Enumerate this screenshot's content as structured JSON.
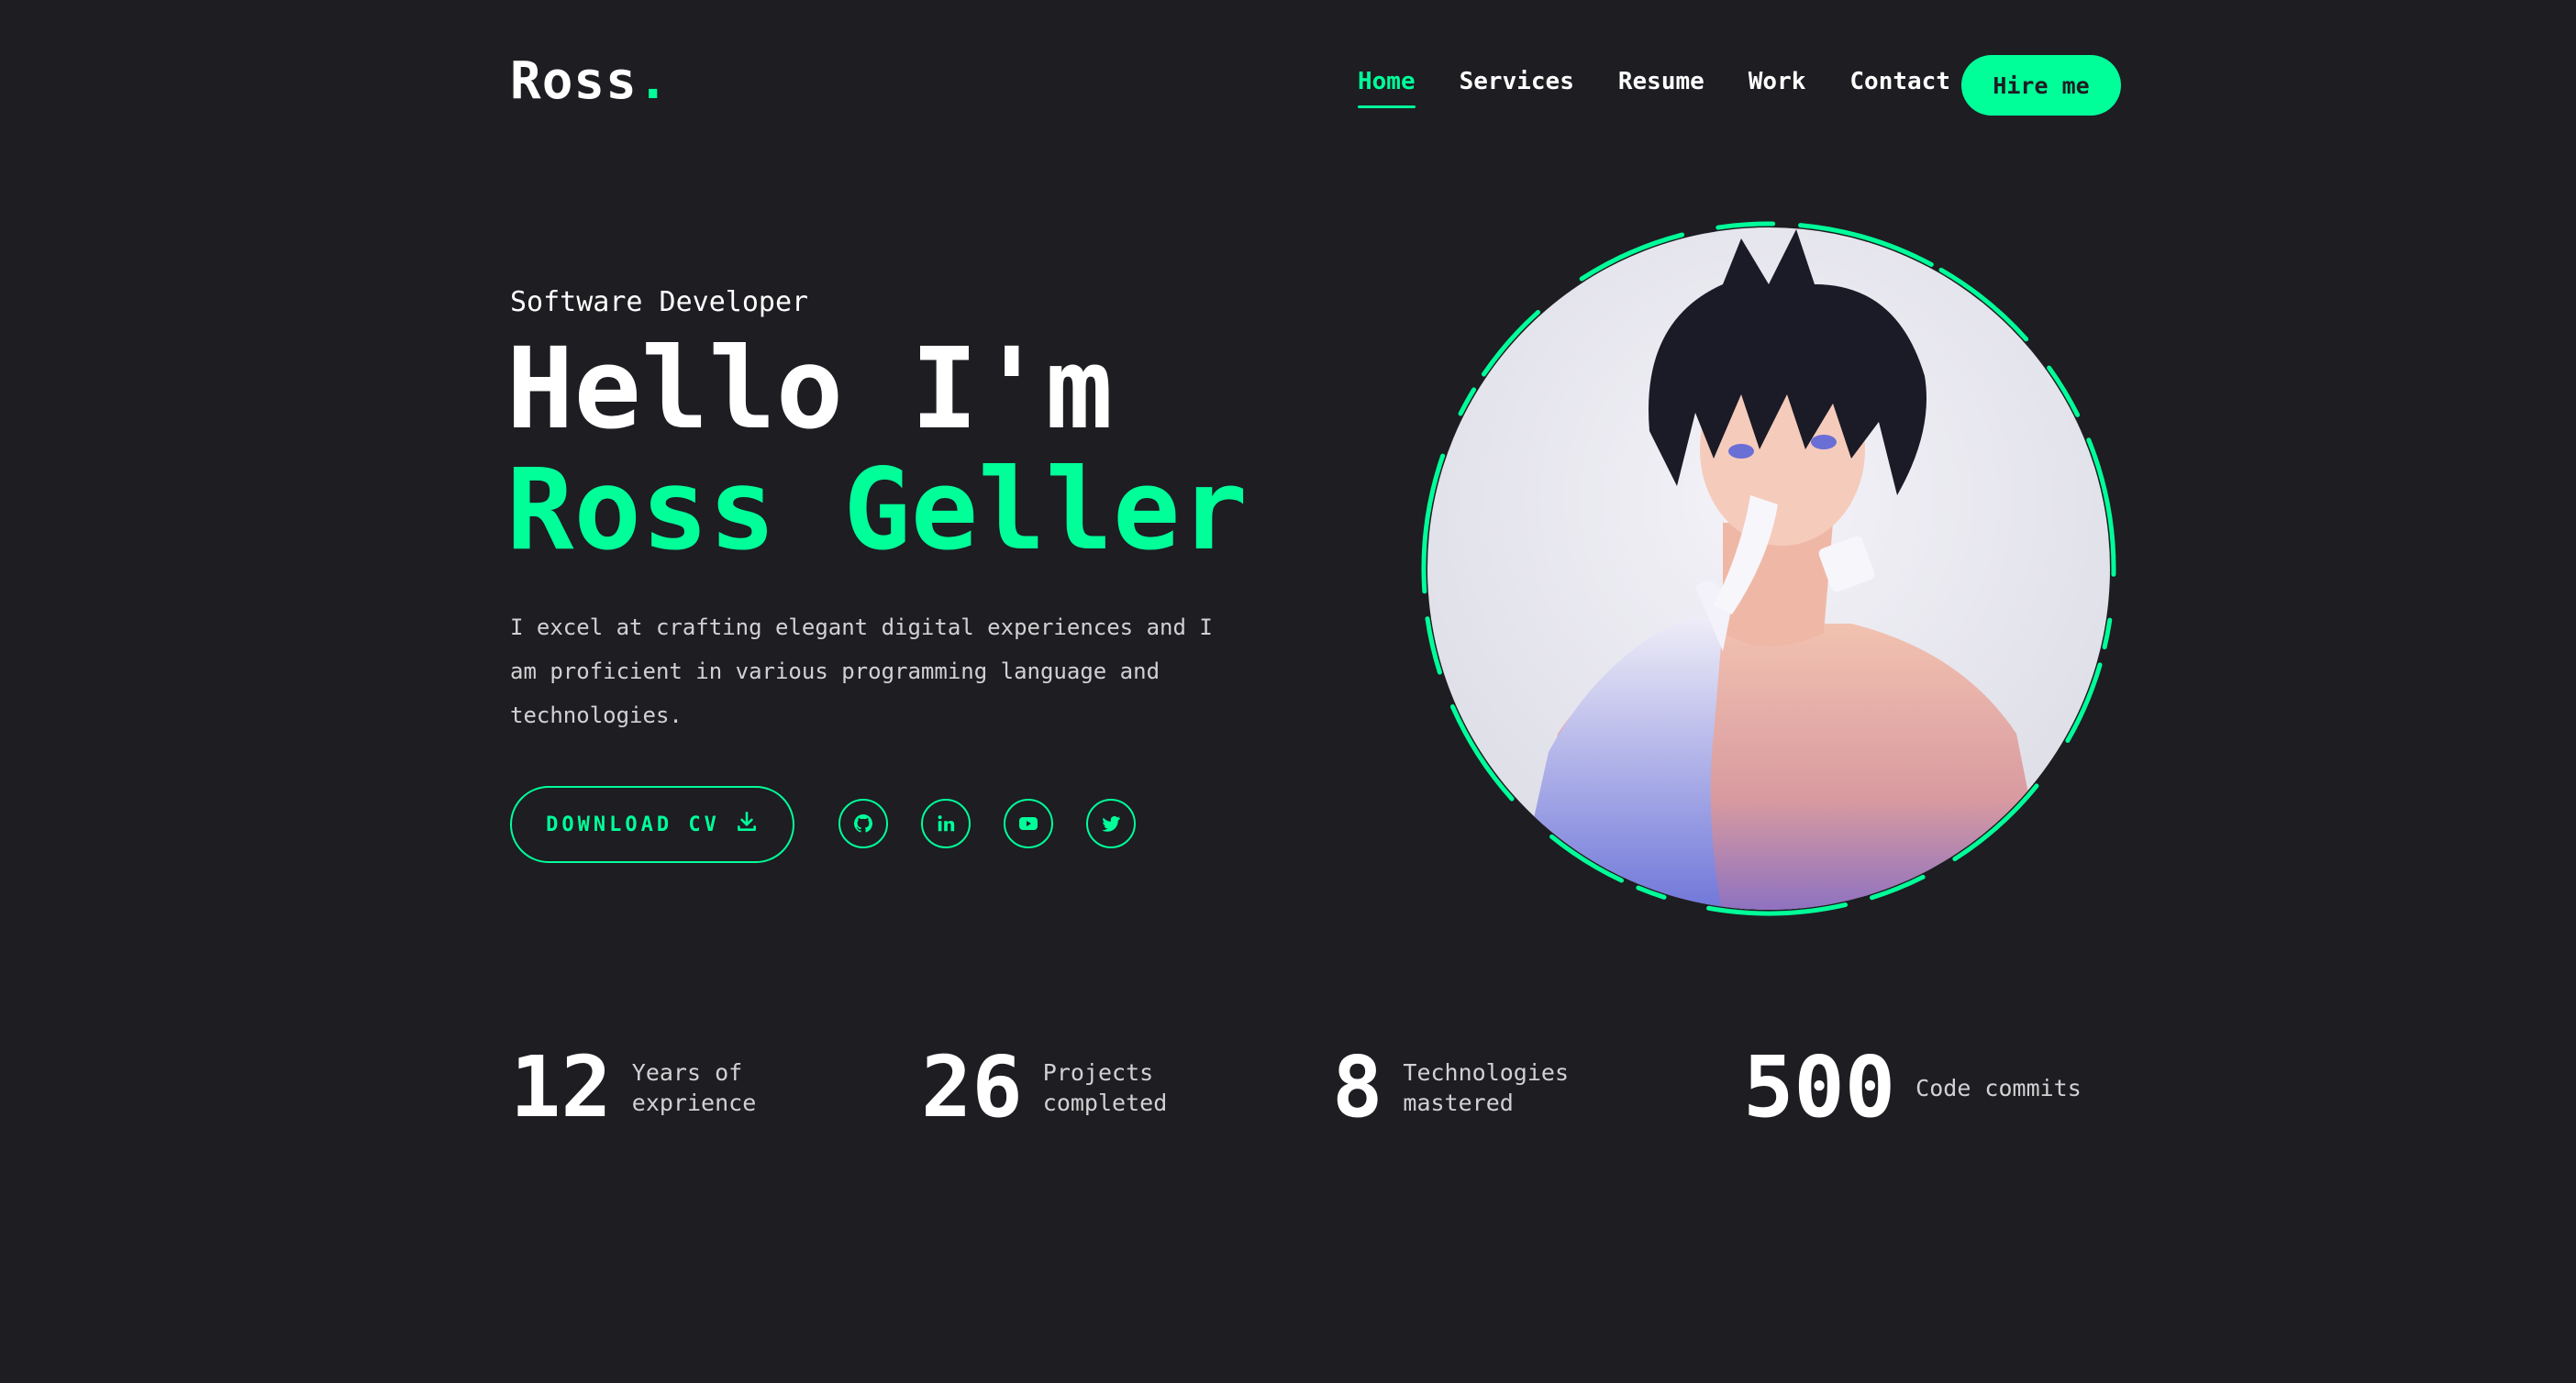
{
  "header": {
    "logo_text": "Ross",
    "logo_dot": ".",
    "nav": [
      {
        "label": "Home",
        "active": true
      },
      {
        "label": "Services"
      },
      {
        "label": "Resume"
      },
      {
        "label": "Work"
      },
      {
        "label": "Contact"
      }
    ],
    "hire_label": "Hire me"
  },
  "hero": {
    "role": "Software Developer",
    "greeting": "Hello I'm",
    "name": "Ross Geller",
    "description": "I excel at crafting elegant digital experiences and I am proficient in various programming language and technologies.",
    "download_label": "DOWNLOAD CV",
    "socials": [
      "github-icon",
      "linkedin-icon",
      "youtube-icon",
      "twitter-icon"
    ]
  },
  "stats": [
    {
      "value": "12",
      "label": "Years of exprience"
    },
    {
      "value": "26",
      "label": "Projects completed"
    },
    {
      "value": "8",
      "label": "Technologies mastered"
    },
    {
      "value": "500",
      "label": "Code commits"
    }
  ],
  "colors": {
    "background": "#1d1d22",
    "accent": "#00ff99",
    "text": "#ffffff"
  }
}
